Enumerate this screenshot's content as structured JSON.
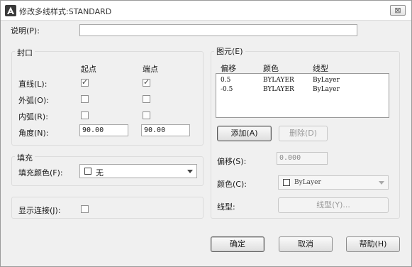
{
  "window": {
    "title": "修改多线样式:STANDARD",
    "close_glyph": "⊠"
  },
  "description": {
    "label": "说明(P):",
    "value": ""
  },
  "caps": {
    "title": "封口",
    "col_start": "起点",
    "col_end": "端点",
    "rows": [
      {
        "label": "直线(L):",
        "start_checked": true,
        "end_checked": true
      },
      {
        "label": "外弧(O):",
        "start_checked": false,
        "end_checked": false
      },
      {
        "label": "内弧(R):",
        "start_checked": false,
        "end_checked": false
      }
    ],
    "angle_label": "角度(N):",
    "angle_start": "90.00",
    "angle_end": "90.00"
  },
  "fill": {
    "title": "填充",
    "color_label": "填充颜色(F):",
    "color_value": "无"
  },
  "display_joints": {
    "label": "显示连接(J):",
    "checked": false
  },
  "elements": {
    "title": "图元(E)",
    "col_offset": "偏移",
    "col_color": "颜色",
    "col_linetype": "线型",
    "rows": [
      {
        "offset": "0.5",
        "color": "BYLAYER",
        "linetype": "ByLayer"
      },
      {
        "offset": "-0.5",
        "color": "BYLAYER",
        "linetype": "ByLayer"
      }
    ],
    "add_button": "添加(A)",
    "delete_button": "删除(D)",
    "offset_label": "偏移(S):",
    "offset_value": "0.000",
    "color_label": "颜色(C):",
    "color_value": "ByLayer",
    "linetype_label": "线型:",
    "linetype_button": "线型(Y)..."
  },
  "footer": {
    "ok": "确定",
    "cancel": "取消",
    "help": "帮助(H)"
  }
}
